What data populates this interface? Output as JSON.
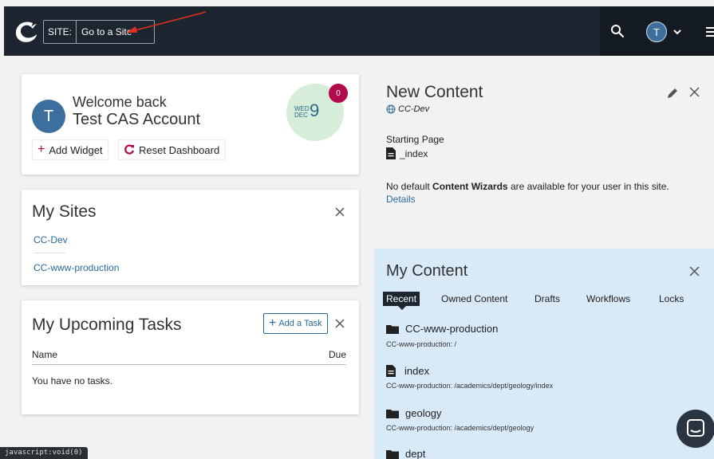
{
  "topbar": {
    "site_label": "SITE:",
    "site_placeholder": "Go to a Site",
    "user_initial": "T"
  },
  "welcome": {
    "line1": "Welcome back",
    "line2": "Test CAS Account",
    "avatar_initial": "T",
    "weekday": "WED",
    "month": "DEC",
    "day": "9",
    "notification_count": "0",
    "add_widget_label": "Add Widget",
    "reset_dashboard_label": "Reset Dashboard"
  },
  "my_sites": {
    "title": "My Sites",
    "items": [
      "CC-Dev",
      "CC-www-production"
    ]
  },
  "tasks": {
    "title": "My Upcoming Tasks",
    "add_task_label": "Add a Task",
    "col_name": "Name",
    "col_due": "Due",
    "empty_text": "You have no tasks."
  },
  "new_content": {
    "title": "New Content",
    "site": "CC-Dev",
    "starting_page_label": "Starting Page",
    "starting_page_value": "_index",
    "no_wizards_prefix": "No default ",
    "no_wizards_bold": "Content Wizards",
    "no_wizards_suffix": " are available for your user in this site.",
    "details_label": "Details"
  },
  "my_content": {
    "title": "My Content",
    "tabs": [
      "Recent",
      "Owned Content",
      "Drafts",
      "Workflows",
      "Locks"
    ],
    "items": [
      {
        "name": "CC-www-production",
        "path": "CC-www-production: /",
        "icon": "folder-icon"
      },
      {
        "name": "index",
        "path": "CC-www-production: /academics/dept/geology/index",
        "icon": "file-icon"
      },
      {
        "name": "geology",
        "path": "CC-www-production: /academics/dept/geology",
        "icon": "folder-icon"
      },
      {
        "name": "dept",
        "path": "",
        "icon": "folder-icon"
      }
    ]
  },
  "status_bar": "javascript:void(0)",
  "colors": {
    "topbar": "#1d2530",
    "accent_red": "#b10b4c",
    "link_blue": "#2a6a9a",
    "panel_blue": "#d8e9f7"
  }
}
